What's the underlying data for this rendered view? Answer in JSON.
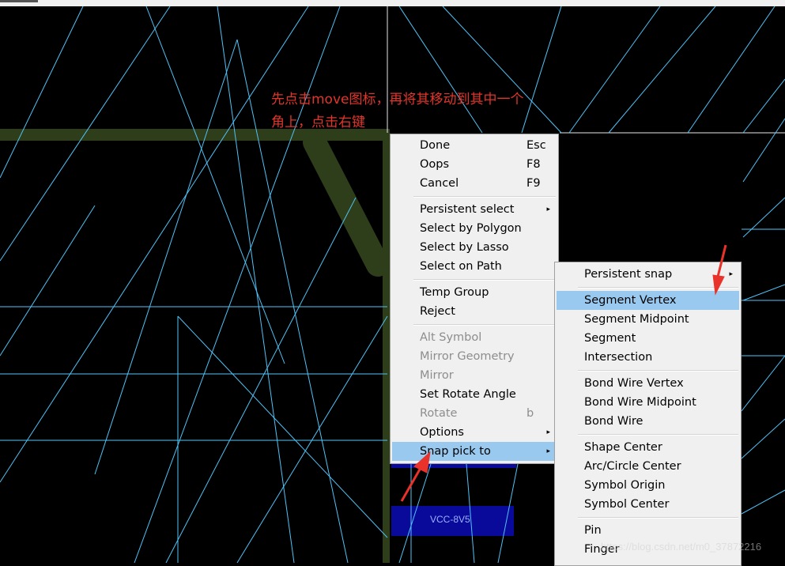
{
  "annotation": {
    "line1": "先点击move图标，再将其移动到其中一个",
    "line2": "角上，点击右键"
  },
  "canvas": {
    "pad_label": "VCC-8V5"
  },
  "main_menu": {
    "items": [
      {
        "label": "Done",
        "key": "Esc"
      },
      {
        "label": "Oops",
        "key": "F8"
      },
      {
        "label": "Cancel",
        "key": "F9"
      },
      {
        "label": "Persistent select",
        "submenu": true
      },
      {
        "label": "Select by Polygon"
      },
      {
        "label": "Select by Lasso"
      },
      {
        "label": "Select on Path"
      },
      {
        "label": "Temp Group"
      },
      {
        "label": "Reject"
      },
      {
        "label": "Alt Symbol",
        "disabled": true
      },
      {
        "label": "Mirror Geometry",
        "disabled": true
      },
      {
        "label": "Mirror",
        "disabled": true
      },
      {
        "label": "Set Rotate Angle"
      },
      {
        "label": "Rotate",
        "key": "b",
        "disabled": true
      },
      {
        "label": "Options",
        "submenu": true
      },
      {
        "label": "Snap pick to",
        "submenu": true,
        "highlighted": true
      }
    ]
  },
  "sub_menu": {
    "items": [
      {
        "label": "Persistent snap",
        "submenu": true
      },
      {
        "label": "Segment Vertex",
        "highlighted": true
      },
      {
        "label": "Segment Midpoint"
      },
      {
        "label": "Segment"
      },
      {
        "label": "Intersection"
      },
      {
        "label": "Bond Wire Vertex"
      },
      {
        "label": "Bond Wire Midpoint"
      },
      {
        "label": "Bond Wire"
      },
      {
        "label": "Shape Center"
      },
      {
        "label": "Arc/Circle Center"
      },
      {
        "label": "Symbol Origin"
      },
      {
        "label": "Symbol Center"
      },
      {
        "label": "Pin"
      },
      {
        "label": "Finger"
      }
    ]
  },
  "arrow_glyph": "▸",
  "watermark": "https://blog.csdn.net/m0_37872216",
  "colors": {
    "background": "#000000",
    "grid_lines": "#4fc3f7",
    "board_outline": "#2e3d1a",
    "pad": "#0a0a9a",
    "annotation": "#e0352b",
    "menu_bg": "#f0f0f0",
    "menu_highlight": "#99c9ef"
  }
}
